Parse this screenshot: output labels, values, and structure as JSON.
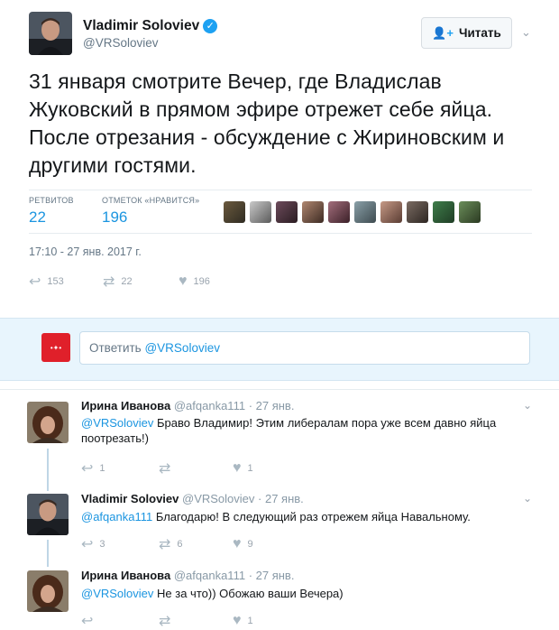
{
  "tweet": {
    "author_name": "Vladimir Soloviev",
    "author_handle": "@VRSoloviev",
    "follow_label": "Читать",
    "text": "31 января смотрите Вечер, где Владислав Жуковский в прямом эфире отрежет себе яйца. После отрезания - обсуждение с Жириновским и другими гостями.",
    "retweets_label": "РЕТВИТОВ",
    "retweets_count": "22",
    "likes_label": "ОТМЕТОК «НРАВИТСЯ»",
    "likes_count": "196",
    "timestamp": "17:10 - 27 янв. 2017 г.",
    "actions": {
      "reply_count": "153",
      "retweet_count": "22",
      "like_count": "196"
    }
  },
  "reply_box": {
    "prefix": "Ответить ",
    "mention": "@VRSoloviev"
  },
  "replies": [
    {
      "name": "Ирина Иванова",
      "handle": "@afqanka111",
      "time": "· 27 янв.",
      "mention": "@VRSoloviev",
      "text": " Браво Владимир! Этим либералам пора уже всем давно яйца поотрезать!)",
      "reply_count": "1",
      "retweet_count": "",
      "like_count": "1"
    },
    {
      "name": "Vladimir Soloviev",
      "handle": "@VRSoloviev",
      "time": "· 27 янв.",
      "mention": "@afqanka111",
      "text": " Благодарю! В следующий раз отрежем яйца Навальному.",
      "reply_count": "3",
      "retweet_count": "6",
      "like_count": "9"
    },
    {
      "name": "Ирина Иванова",
      "handle": "@afqanka111",
      "time": "· 27 янв.",
      "mention": "@VRSoloviev",
      "text": " Не за что)) Обожаю ваши Вечера)",
      "reply_count": "",
      "retweet_count": "",
      "like_count": "1"
    }
  ],
  "icons": {
    "reply": "reply-icon",
    "retweet": "retweet-icon",
    "like": "heart-icon",
    "follow": "add-user-icon",
    "verified": "verified-badge-icon",
    "more": "chevron-down-icon"
  },
  "colors": {
    "accent": "#1da1f2",
    "link": "#1b95e0",
    "reply_band": "#e8f5fd"
  }
}
